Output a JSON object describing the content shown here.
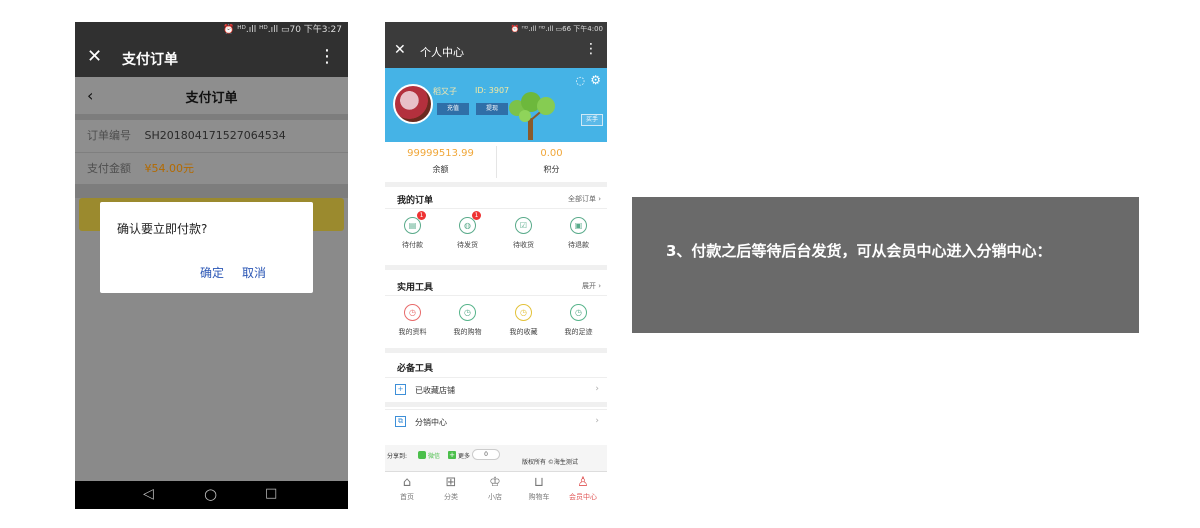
{
  "phone1": {
    "status": "⏰ ᴴᴰ.ıll ᴴᴰ.ıll ▭70 下午3:27",
    "app_title": "支付订单",
    "header_title": "支付订单",
    "order_label": "订单编号",
    "order_value": "SH201804171527064534",
    "amount_label": "支付金额",
    "amount_value": "¥54.00元",
    "dialog": {
      "message": "确认要立即付款?",
      "confirm": "确定",
      "cancel": "取消"
    }
  },
  "phone2": {
    "status": "⏰ ᴴᴰ.ıll ᴴᴰ.ıll ▭66 下午4:00",
    "app_title": "个人中心",
    "user": {
      "name": "稻又子",
      "id": "ID: 3907"
    },
    "recharge": "充值",
    "withdraw": "提现",
    "tag": "买手",
    "balance_value": "99999513.99",
    "balance_label": "余额",
    "points_value": "0.00",
    "points_label": "积分",
    "orders": {
      "title": "我的订单",
      "link": "全部订单 ›",
      "items": [
        {
          "label": "待付款",
          "badge": "1"
        },
        {
          "label": "待发货",
          "badge": "1"
        },
        {
          "label": "待收货"
        },
        {
          "label": "待退款"
        }
      ]
    },
    "tools": {
      "title": "实用工具",
      "link": "展开 ›",
      "items": [
        {
          "label": "我的资料"
        },
        {
          "label": "我的购物"
        },
        {
          "label": "我的收藏"
        },
        {
          "label": "我的足迹"
        }
      ]
    },
    "essentials": {
      "title": "必备工具",
      "rows": [
        {
          "label": "已收藏店铺"
        },
        {
          "label": "分销中心"
        }
      ]
    },
    "share": {
      "label": "分享到:",
      "wechat": "微信",
      "more": "更多",
      "count": "0",
      "copyright": "版权所有 ©海生测试"
    },
    "tabs": [
      {
        "label": "首页",
        "icon": "home-icon"
      },
      {
        "label": "分类",
        "icon": "grid-icon"
      },
      {
        "label": "小店",
        "icon": "crown-icon"
      },
      {
        "label": "购物车",
        "icon": "cart-icon"
      },
      {
        "label": "会员中心",
        "icon": "user-icon",
        "active": true
      }
    ]
  },
  "caption": {
    "text": "3、付款之后等待后台发货，可从会员中心进入分销中心："
  }
}
